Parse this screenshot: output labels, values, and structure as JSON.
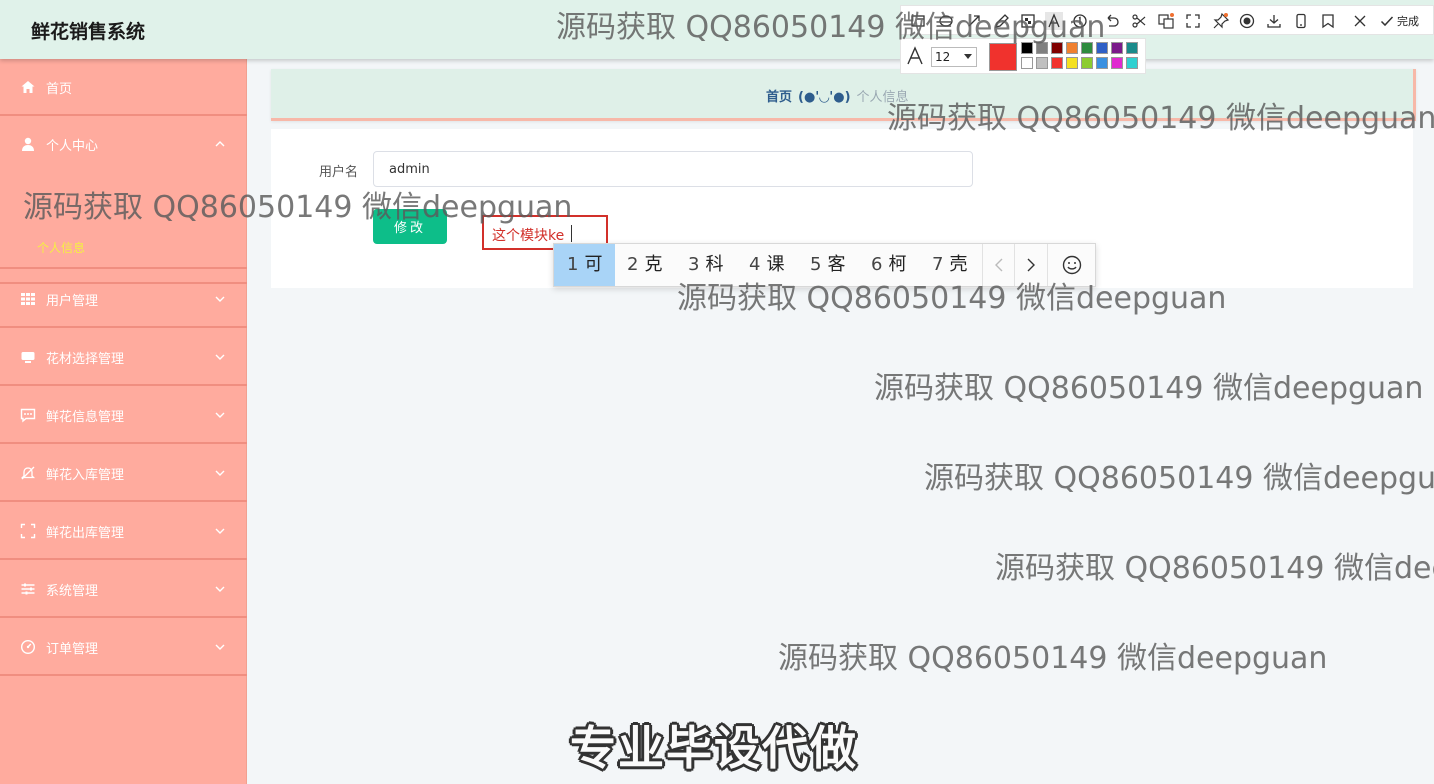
{
  "header": {
    "title": "鲜花销售系统"
  },
  "sidebar": {
    "items": [
      {
        "label": "首页",
        "icon": "home-icon",
        "expanded": false
      },
      {
        "label": "个人中心",
        "icon": "user-icon",
        "expanded": true,
        "children": [
          {
            "label": "个人信息"
          }
        ]
      },
      {
        "label": "用户管理",
        "icon": "grid-icon"
      },
      {
        "label": "花材选择管理",
        "icon": "device-icon"
      },
      {
        "label": "鲜花信息管理",
        "icon": "message-icon"
      },
      {
        "label": "鲜花入库管理",
        "icon": "bell-off-icon"
      },
      {
        "label": "鲜花出库管理",
        "icon": "scan-icon"
      },
      {
        "label": "系统管理",
        "icon": "sliders-icon"
      },
      {
        "label": "订单管理",
        "icon": "gauge-icon"
      }
    ]
  },
  "breadcrumb": {
    "home": "首页",
    "separator": "(●'◡'●)",
    "current": "个人信息"
  },
  "form": {
    "username_label": "用户名",
    "username_value": "admin",
    "submit_label": "修改"
  },
  "annotation": {
    "text": "这个模块ke"
  },
  "ime": {
    "candidates": [
      {
        "num": "1",
        "char": "可"
      },
      {
        "num": "2",
        "char": "克"
      },
      {
        "num": "3",
        "char": "科"
      },
      {
        "num": "4",
        "char": "课"
      },
      {
        "num": "5",
        "char": "客"
      },
      {
        "num": "6",
        "char": "柯"
      },
      {
        "num": "7",
        "char": "壳"
      }
    ]
  },
  "toolbar": {
    "done_label": "完成",
    "font_size": "12",
    "current_color": "#f0322d",
    "palette": [
      "#000000",
      "#808080",
      "#800000",
      "#f08030",
      "#2e8b3e",
      "#2f5fc6",
      "#7a1a8a",
      "#1a8a8a",
      "#ffffff",
      "#c0c0c0",
      "#f0322d",
      "#f5e020",
      "#8ccc30",
      "#3a90e0",
      "#e02ad0",
      "#30d0d0"
    ]
  },
  "watermark": {
    "text": "源码获取 QQ86050149 微信deepguan",
    "banner": "专业毕设代做"
  },
  "colors": {
    "sidebar": "#ffab9e",
    "header": "#e0f2ea",
    "accent_button": "#0dbe89",
    "submenu_active": "#f5ef43"
  }
}
